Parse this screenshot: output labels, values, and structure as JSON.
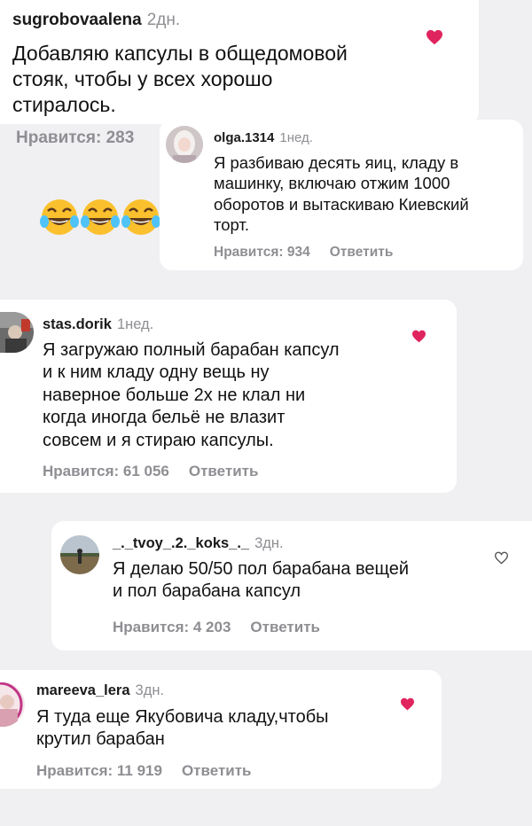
{
  "comments": [
    {
      "username": "sugrobovaalena",
      "time": "2дн.",
      "lines": [
        "Добавляю капсулы в общедомовой",
        "стояк, чтобы у всех хорошо",
        "стиралось."
      ],
      "likes": "Нравится: 283",
      "reply": "",
      "liked": true
    },
    {
      "username": "olga.1314",
      "time": "1нед.",
      "lines": [
        "Я разбиваю десять яиц, кладу в",
        "машинку, включаю отжим 1000",
        "оборотов и вытаскиваю Киевский",
        "торт."
      ],
      "likes": "Нравится: 934",
      "reply": "Ответить",
      "liked": false
    },
    {
      "username": "stas.dorik",
      "time": "1нед.",
      "lines": [
        "Я загружаю полный барабан капсул",
        "и к ним кладу одну вещь ну",
        "наверное больше 2х не клал ни",
        "когда иногда бельё не влазит",
        "совсем и я стираю капсулы."
      ],
      "likes": "Нравится: 61 056",
      "reply": "Ответить",
      "liked": true
    },
    {
      "username": "_._tvoy_.2._koks_._",
      "time": "3дн.",
      "lines": [
        "Я делаю 50/50 пол барабана вещей",
        "и пол барабана капсул"
      ],
      "likes": "Нравится: 4 203",
      "reply": "Ответить",
      "liked": false
    },
    {
      "username": "mareeva_lera",
      "time": "3дн.",
      "lines": [
        "Я туда еще Якубовича кладу,чтобы",
        "крутил барабан"
      ],
      "likes": "Нравится: 11 919",
      "reply": "Ответить",
      "liked": true
    }
  ],
  "emoji_reaction": "face-with-tears-of-joy x3",
  "colors": {
    "heart_red": "#e0245e",
    "muted": "#8e8e93",
    "card": "#ffffff",
    "background": "#f0f0f3"
  }
}
